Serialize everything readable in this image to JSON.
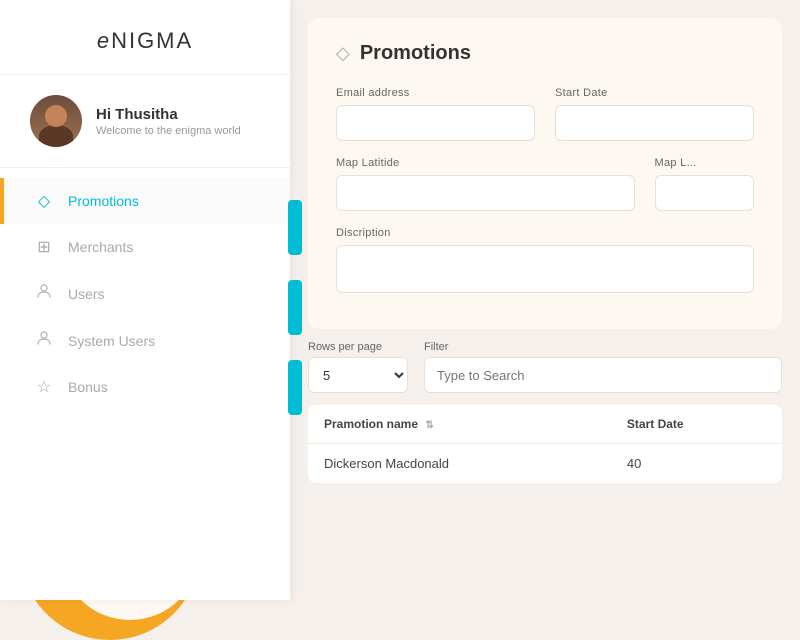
{
  "logo": {
    "prefix": "e",
    "suffix": "NIGMA"
  },
  "user": {
    "greeting": "Hi Thusitha",
    "subtitle": "Welcome to the enigma world"
  },
  "nav": {
    "items": [
      {
        "id": "promotions",
        "label": "Promotions",
        "icon": "◇",
        "active": true
      },
      {
        "id": "merchants",
        "label": "Merchants",
        "icon": "⊞",
        "active": false
      },
      {
        "id": "users",
        "label": "Users",
        "icon": "👤",
        "active": false
      },
      {
        "id": "system-users",
        "label": "System Users",
        "icon": "👤",
        "active": false
      },
      {
        "id": "bonus",
        "label": "Bonus",
        "icon": "☆",
        "active": false
      }
    ]
  },
  "page": {
    "title": "Promotions",
    "icon": "◇"
  },
  "form": {
    "email_label": "Email address",
    "email_placeholder": "",
    "start_date_label": "Start Date",
    "start_date_placeholder": "",
    "map_lat_label": "Map Latitide",
    "map_lat_placeholder": "",
    "map_lng_label": "Map L...",
    "description_label": "Discription",
    "description_placeholder": ""
  },
  "table_controls": {
    "rows_per_page_label": "Rows per page",
    "rows_per_page_value": "5",
    "filter_label": "Filter",
    "filter_placeholder": "Type to Search"
  },
  "table": {
    "columns": [
      {
        "label": "Pramotion name",
        "key": "name",
        "sortable": true
      },
      {
        "label": "Start Date",
        "key": "start_date",
        "sortable": false
      }
    ],
    "rows": [
      {
        "name": "Dickerson Macdonald",
        "start_date": "40"
      }
    ]
  }
}
